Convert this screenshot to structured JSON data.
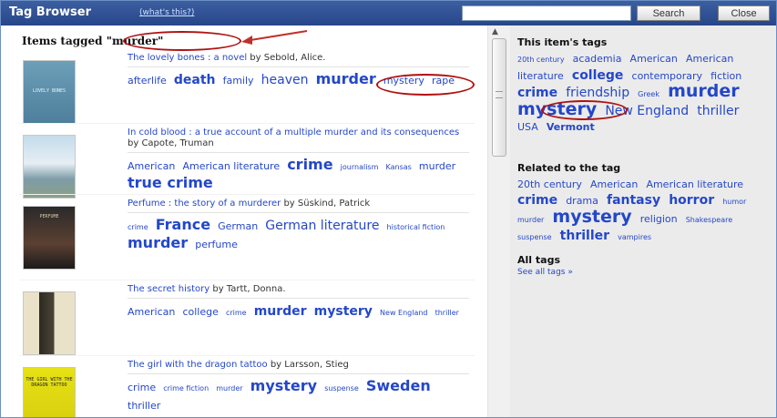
{
  "header": {
    "title": "Tag Browser",
    "help_link": "(what's this?)",
    "search_value": "",
    "search_button": "Search",
    "close_button": "Close"
  },
  "main": {
    "items_tagged_prefix": "Items tagged ",
    "items_tagged_tag": "\"murder\"",
    "items": [
      {
        "title": "The lovely bones : a novel",
        "author": "by Sebold, Alice.",
        "cover_text": "LOVELY BONES",
        "tags": [
          {
            "text": "afterlife",
            "size": 2,
            "bold": false
          },
          {
            "text": "death",
            "size": 3,
            "bold": true
          },
          {
            "text": "family",
            "size": 2,
            "bold": false
          },
          {
            "text": "heaven",
            "size": 3,
            "bold": false
          },
          {
            "text": "murder",
            "size": 4,
            "bold": true
          },
          {
            "text": "mystery",
            "size": 2,
            "bold": false
          },
          {
            "text": "rape",
            "size": 2,
            "bold": false
          }
        ]
      },
      {
        "title": "In cold blood : a true account of a multiple murder and its consequences",
        "author": "by Capote, Truman",
        "cover_text": "",
        "tags": [
          {
            "text": "American",
            "size": 2,
            "bold": false
          },
          {
            "text": "American literature",
            "size": 2,
            "bold": false
          },
          {
            "text": "crime",
            "size": 4,
            "bold": true
          },
          {
            "text": "journalism",
            "size": 1,
            "bold": false
          },
          {
            "text": "Kansas",
            "size": 1,
            "bold": false
          },
          {
            "text": "murder",
            "size": 2,
            "bold": false
          },
          {
            "text": "true crime",
            "size": 4,
            "bold": true
          }
        ]
      },
      {
        "title": "Perfume : the story of a murderer",
        "author": "by Süskind, Patrick",
        "cover_text": "PERFUME",
        "tags": [
          {
            "text": "crime",
            "size": 1,
            "bold": false
          },
          {
            "text": "France",
            "size": 4,
            "bold": true
          },
          {
            "text": "German",
            "size": 2,
            "bold": false
          },
          {
            "text": "German literature",
            "size": 3,
            "bold": false
          },
          {
            "text": "historical fiction",
            "size": 1,
            "bold": false
          },
          {
            "text": "murder",
            "size": 4,
            "bold": true
          },
          {
            "text": "perfume",
            "size": 2,
            "bold": false
          }
        ]
      },
      {
        "title": "The secret history",
        "author": "by Tartt, Donna.",
        "cover_text": "",
        "tags": [
          {
            "text": "American",
            "size": 2,
            "bold": false
          },
          {
            "text": "college",
            "size": 2,
            "bold": false
          },
          {
            "text": "crime",
            "size": 1,
            "bold": false
          },
          {
            "text": "murder",
            "size": 3,
            "bold": true
          },
          {
            "text": "mystery",
            "size": 3,
            "bold": true
          },
          {
            "text": "New England",
            "size": 1,
            "bold": false
          },
          {
            "text": "thriller",
            "size": 1,
            "bold": false
          }
        ]
      },
      {
        "title": "The girl with the dragon tattoo",
        "author": "by Larsson, Stieg",
        "cover_text": "THE GIRL WITH THE DRAGON TATTOO",
        "tags": [
          {
            "text": "crime",
            "size": 2,
            "bold": false
          },
          {
            "text": "crime fiction",
            "size": 1,
            "bold": false
          },
          {
            "text": "murder",
            "size": 1,
            "bold": false
          },
          {
            "text": "mystery",
            "size": 4,
            "bold": true
          },
          {
            "text": "suspense",
            "size": 1,
            "bold": false
          },
          {
            "text": "Sweden",
            "size": 4,
            "bold": true
          },
          {
            "text": "thriller",
            "size": 2,
            "bold": false
          }
        ]
      }
    ]
  },
  "sidebar": {
    "item_tags_heading": "This item's tags",
    "item_tags": [
      {
        "text": "20th century",
        "size": 1,
        "bold": false
      },
      {
        "text": "academia",
        "size": 2,
        "bold": false
      },
      {
        "text": "American",
        "size": 2,
        "bold": false
      },
      {
        "text": "American literature",
        "size": 2,
        "bold": false
      },
      {
        "text": "college",
        "size": 3,
        "bold": true
      },
      {
        "text": "contemporary",
        "size": 2,
        "bold": false
      },
      {
        "text": "fiction",
        "size": 2,
        "bold": false
      },
      {
        "text": "crime",
        "size": 3,
        "bold": true
      },
      {
        "text": "friendship",
        "size": 3,
        "bold": false
      },
      {
        "text": "Greek",
        "size": 1,
        "bold": false
      },
      {
        "text": "murder",
        "size": 5,
        "bold": true
      },
      {
        "text": "mystery",
        "size": 5,
        "bold": true
      },
      {
        "text": "New England",
        "size": 3,
        "bold": false
      },
      {
        "text": "thriller",
        "size": 3,
        "bold": false
      },
      {
        "text": "USA",
        "size": 2,
        "bold": false
      },
      {
        "text": "Vermont",
        "size": 2,
        "bold": true
      }
    ],
    "related_heading": "Related to the tag",
    "related_tags": [
      {
        "text": "20th century",
        "size": 2,
        "bold": false
      },
      {
        "text": "American",
        "size": 2,
        "bold": false
      },
      {
        "text": "American literature",
        "size": 2,
        "bold": false
      },
      {
        "text": "crime",
        "size": 3,
        "bold": true
      },
      {
        "text": "drama",
        "size": 2,
        "bold": false
      },
      {
        "text": "fantasy",
        "size": 3,
        "bold": true
      },
      {
        "text": "horror",
        "size": 3,
        "bold": true
      },
      {
        "text": "humor",
        "size": 1,
        "bold": false
      },
      {
        "text": "murder",
        "size": 1,
        "bold": false
      },
      {
        "text": "mystery",
        "size": 5,
        "bold": true
      },
      {
        "text": "religion",
        "size": 2,
        "bold": false
      },
      {
        "text": "Shakespeare",
        "size": 1,
        "bold": false
      },
      {
        "text": "suspense",
        "size": 1,
        "bold": false
      },
      {
        "text": "thriller",
        "size": 3,
        "bold": true
      },
      {
        "text": "vampires",
        "size": 1,
        "bold": false
      }
    ],
    "all_tags_heading": "All tags",
    "see_all_link": "See all tags »"
  }
}
